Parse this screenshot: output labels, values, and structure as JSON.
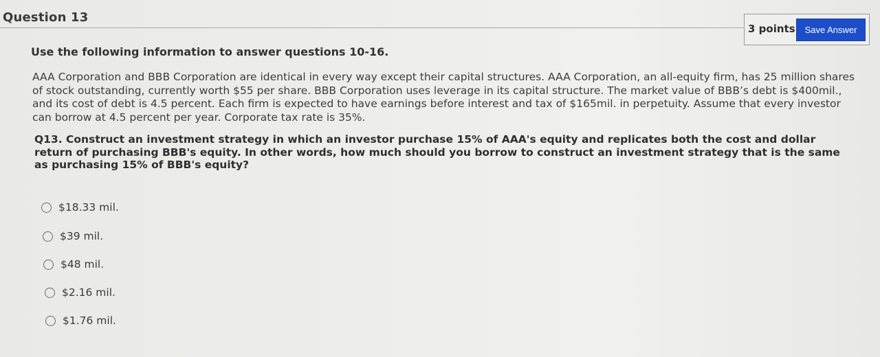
{
  "question": {
    "title": "Question 13",
    "points": "3 points",
    "save_label": "Save Answer",
    "intro": "Use the following information to answer questions 10-16.",
    "passage": "AAA Corporation and BBB Corporation are identical in every way except their capital structures. AAA Corporation, an all-equity firm, has 25 million shares of stock outstanding, currently worth $55 per share. BBB Corporation uses leverage in its capital structure. The market value of BBB’s debt is $400mil., and its cost of debt is 4.5 percent. Each firm is expected to have earnings before interest and tax of $165mil. in perpetuity. Assume that every investor can borrow at 4.5 percent per year. Corporate tax rate is 35%.",
    "prompt": "Q13. Construct an investment strategy in which an investor purchase 15% of AAA's equity and replicates both the cost and dollar return of purchasing BBB's equity. In other words, how much should you borrow to construct an investment strategy that is the same as purchasing 15% of BBB's equity?",
    "options": [
      {
        "label": "$18.33 mil."
      },
      {
        "label": "$39 mil."
      },
      {
        "label": "$48 mil."
      },
      {
        "label": "$2.16 mil."
      },
      {
        "label": "$1.76 mil."
      }
    ]
  }
}
